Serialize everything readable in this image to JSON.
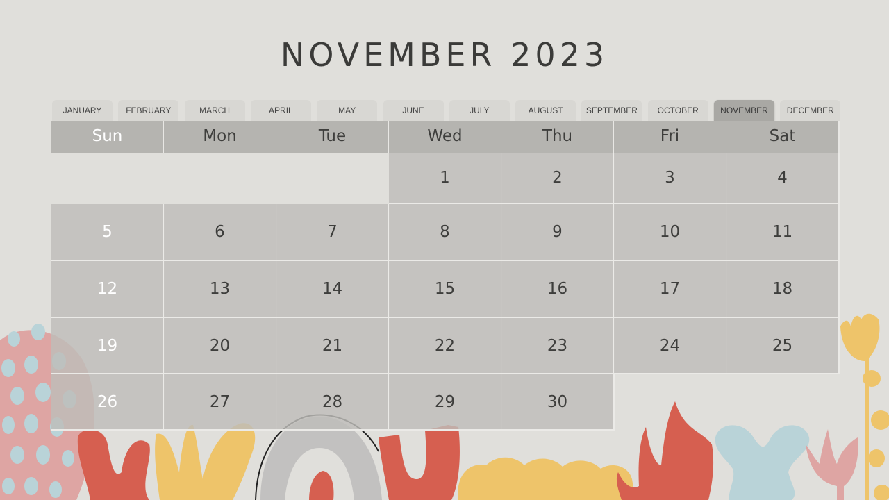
{
  "title": "NOVEMBER 2023",
  "months": [
    "JANUARY",
    "FEBRUARY",
    "MARCH",
    "APRIL",
    "MAY",
    "JUNE",
    "JULY",
    "AUGUST",
    "SEPTEMBER",
    "OCTOBER",
    "NOVEMBER",
    "DECEMBER"
  ],
  "active_month_index": 10,
  "weekdays": [
    "Sun",
    "Mon",
    "Tue",
    "Wed",
    "Thu",
    "Fri",
    "Sat"
  ],
  "first_weekday_index": 3,
  "days_in_month": 30,
  "colors": {
    "background": "#e0dfdb",
    "header_cell": "#b5b4b0",
    "day_cell": "#c4c3bf",
    "active_tab": "#a9a8a4",
    "coral": "#d65f50",
    "mustard": "#eec46a",
    "pink": "#dea5a3",
    "light_blue": "#b9d3d8"
  }
}
